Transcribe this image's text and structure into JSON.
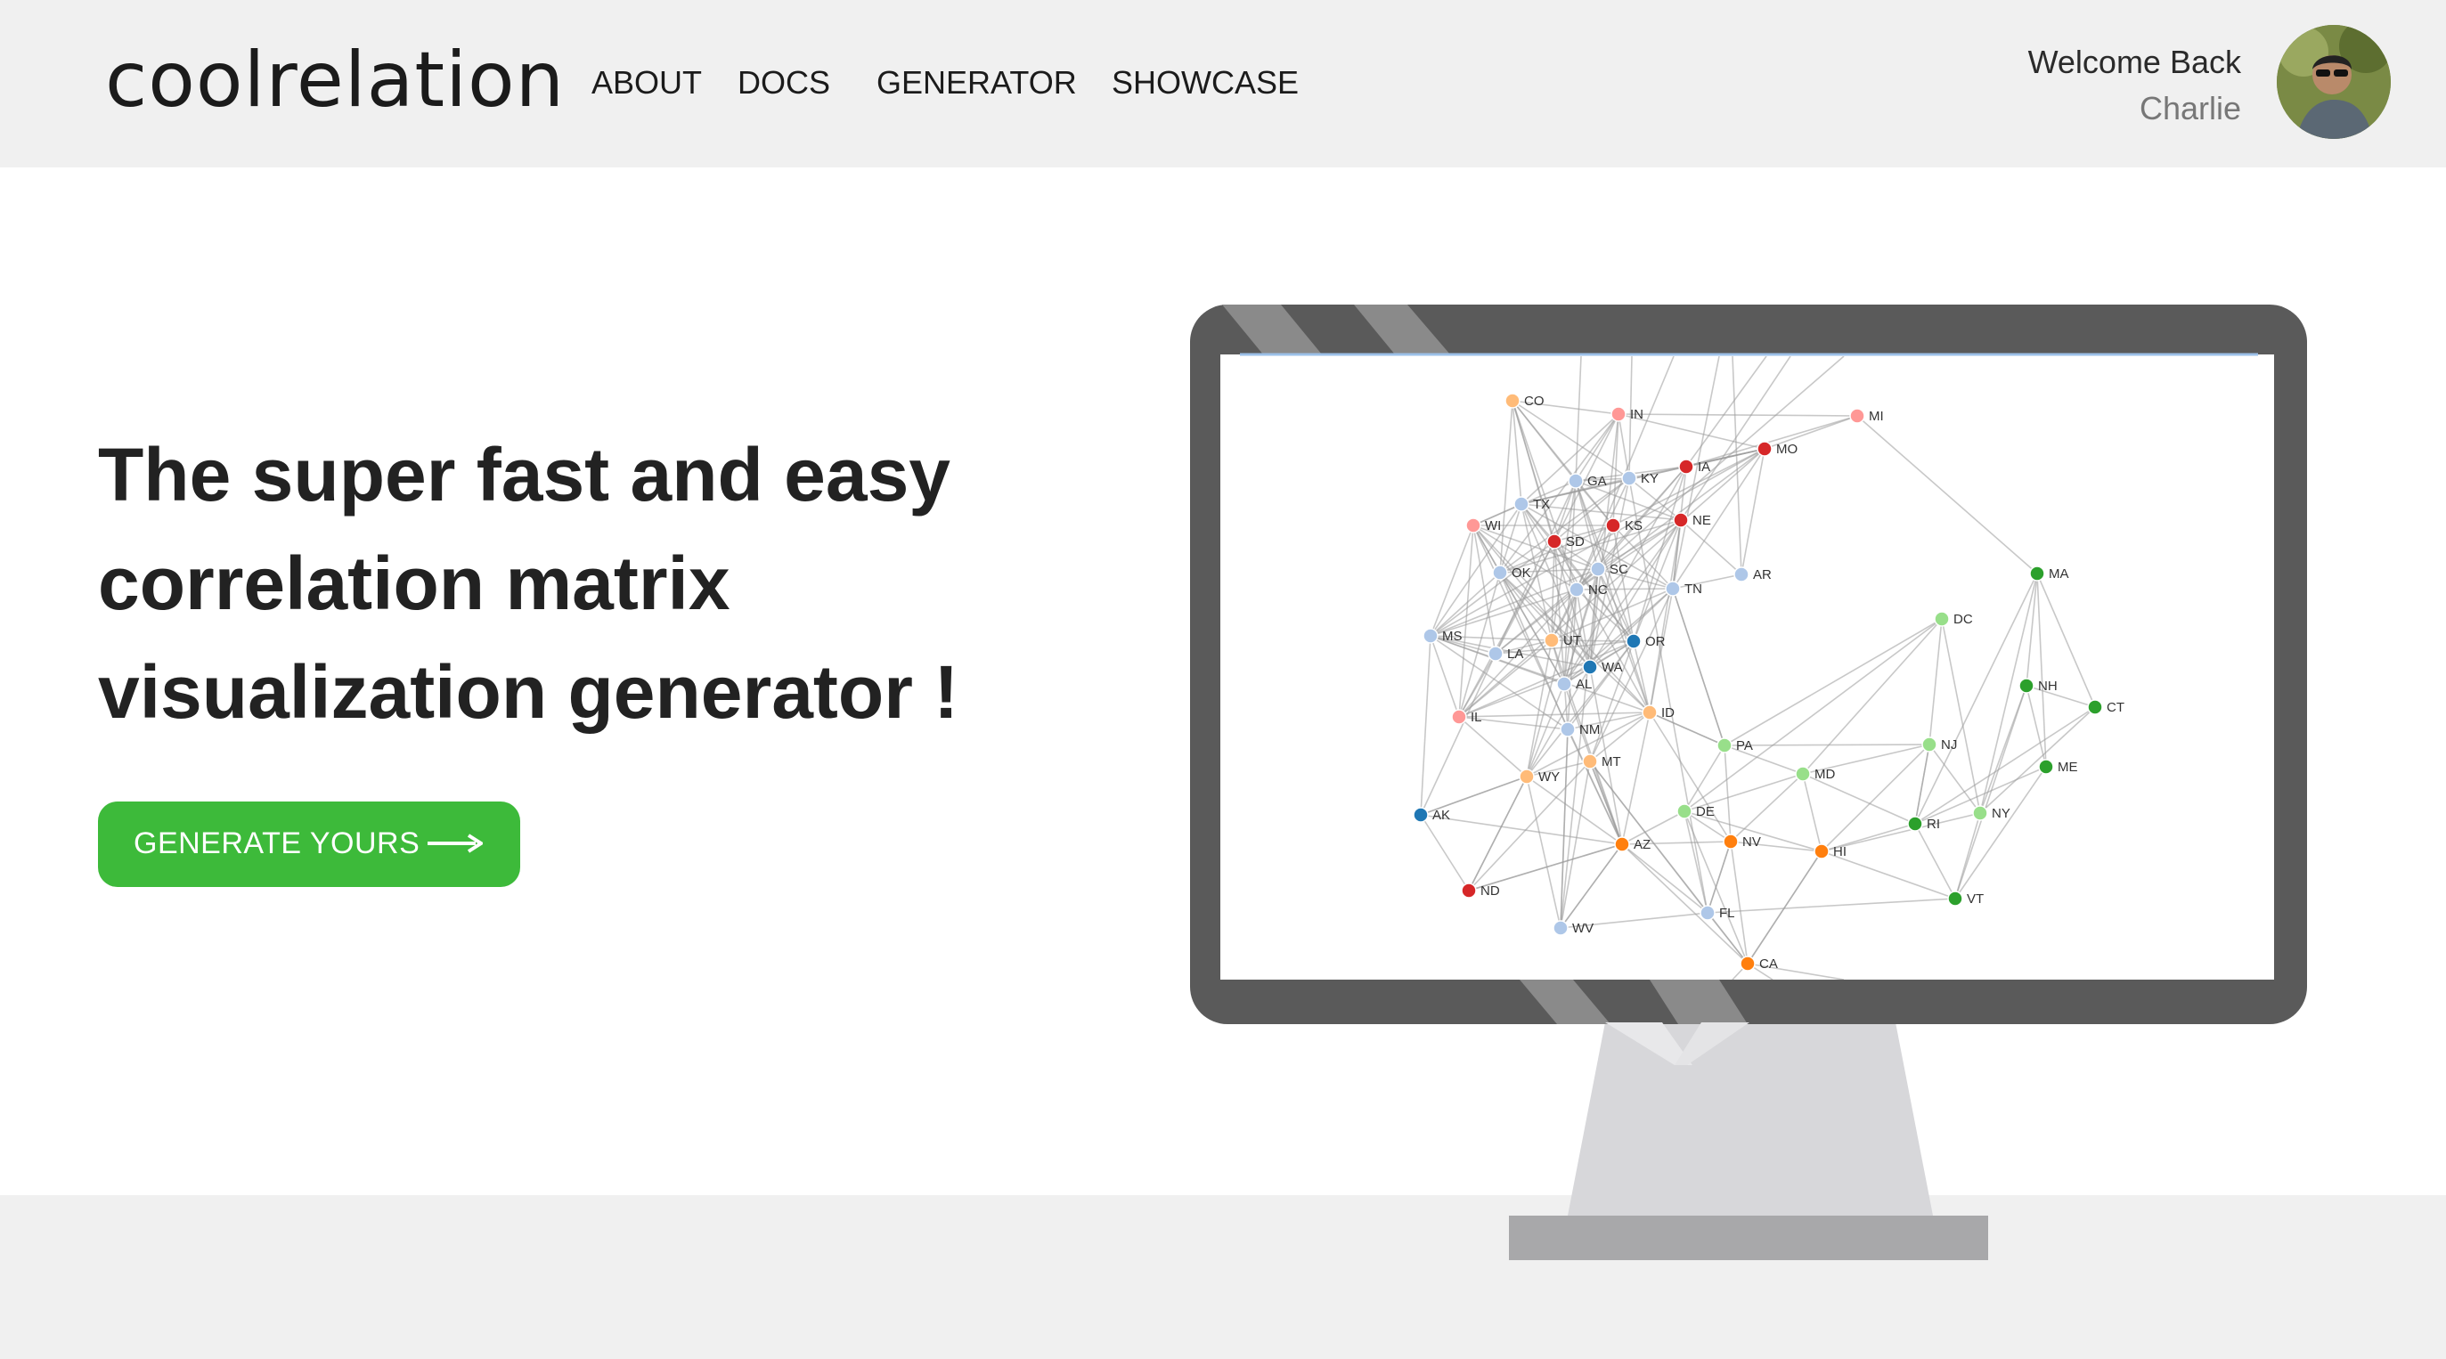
{
  "header": {
    "logo": "coolrelation",
    "nav": [
      {
        "label": "ABOUT"
      },
      {
        "label": "DOCS"
      },
      {
        "label": "GENERATOR"
      },
      {
        "label": "SHOWCASE"
      }
    ],
    "welcome": "Welcome Back",
    "user_name": "Charlie"
  },
  "hero": {
    "headline_lines": [
      "The super fast and easy",
      "correlation matrix",
      "visualization generator !"
    ],
    "cta_label": "GENERATE YOURS",
    "cta_color": "#3dba3a"
  },
  "icons": {
    "cta_arrow": "arrow-right-icon",
    "avatar": "user-avatar"
  },
  "network": {
    "nodes": [
      {
        "label": "CO",
        "color": "#ffbb78"
      },
      {
        "label": "IN",
        "color": "#ff9896"
      },
      {
        "label": "MI",
        "color": "#ff9896"
      },
      {
        "label": "IA",
        "color": "#d62728"
      },
      {
        "label": "MO",
        "color": "#d62728"
      },
      {
        "label": "GA",
        "color": "#aec7e8"
      },
      {
        "label": "KY",
        "color": "#aec7e8"
      },
      {
        "label": "TX",
        "color": "#aec7e8"
      },
      {
        "label": "WI",
        "color": "#ff9896"
      },
      {
        "label": "SD",
        "color": "#d62728"
      },
      {
        "label": "KS",
        "color": "#d62728"
      },
      {
        "label": "NE",
        "color": "#d62728"
      },
      {
        "label": "SC",
        "color": "#aec7e8"
      },
      {
        "label": "OK",
        "color": "#aec7e8"
      },
      {
        "label": "NC",
        "color": "#aec7e8"
      },
      {
        "label": "TN",
        "color": "#aec7e8"
      },
      {
        "label": "AR",
        "color": "#aec7e8"
      },
      {
        "label": "MA",
        "color": "#2ca02c"
      },
      {
        "label": "DC",
        "color": "#98df8a"
      },
      {
        "label": "MS",
        "color": "#aec7e8"
      },
      {
        "label": "LA",
        "color": "#aec7e8"
      },
      {
        "label": "UT",
        "color": "#ffbb78"
      },
      {
        "label": "OR",
        "color": "#1f77b4"
      },
      {
        "label": "WA",
        "color": "#1f77b4"
      },
      {
        "label": "AL",
        "color": "#aec7e8"
      },
      {
        "label": "NH",
        "color": "#2ca02c"
      },
      {
        "label": "CT",
        "color": "#2ca02c"
      },
      {
        "label": "IL",
        "color": "#ff9896"
      },
      {
        "label": "NM",
        "color": "#aec7e8"
      },
      {
        "label": "ID",
        "color": "#ffbb78"
      },
      {
        "label": "PA",
        "color": "#98df8a"
      },
      {
        "label": "NJ",
        "color": "#98df8a"
      },
      {
        "label": "ME",
        "color": "#2ca02c"
      },
      {
        "label": "WY",
        "color": "#ffbb78"
      },
      {
        "label": "MT",
        "color": "#ffbb78"
      },
      {
        "label": "MD",
        "color": "#98df8a"
      },
      {
        "label": "AK",
        "color": "#1f77b4"
      },
      {
        "label": "DE",
        "color": "#98df8a"
      },
      {
        "label": "RI",
        "color": "#2ca02c"
      },
      {
        "label": "NY",
        "color": "#98df8a"
      },
      {
        "label": "AZ",
        "color": "#ff7f0e"
      },
      {
        "label": "NV",
        "color": "#ff7f0e"
      },
      {
        "label": "HI",
        "color": "#ff7f0e"
      },
      {
        "label": "ND",
        "color": "#d62728"
      },
      {
        "label": "VT",
        "color": "#2ca02c"
      },
      {
        "label": "FL",
        "color": "#aec7e8"
      },
      {
        "label": "WV",
        "color": "#aec7e8"
      },
      {
        "label": "CA",
        "color": "#ff7f0e"
      }
    ]
  }
}
